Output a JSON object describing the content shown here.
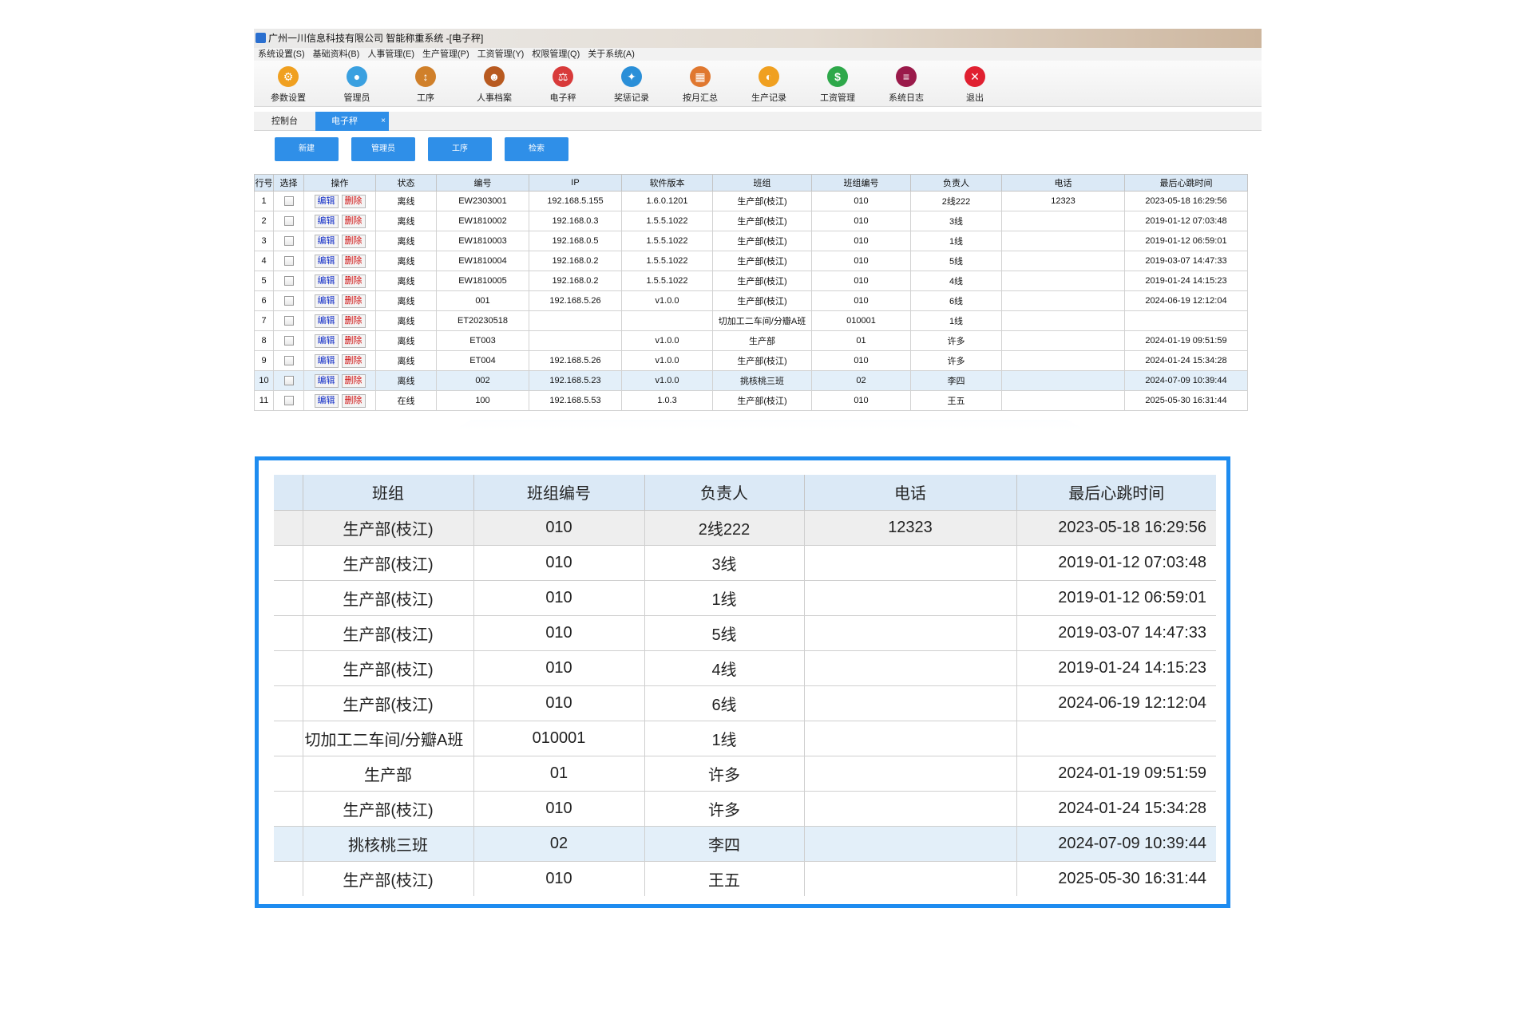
{
  "window": {
    "title": "广州一川信息科技有限公司 智能称重系统 -[电子秤]"
  },
  "menu": [
    "系统设置(S)",
    "基础资料(B)",
    "人事管理(E)",
    "生产管理(P)",
    "工资管理(Y)",
    "权限管理(Q)",
    "关于系统(A)"
  ],
  "toolbar": [
    {
      "label": "参数设置",
      "icon": "gear-icon",
      "color": "#f0a020",
      "glyph": "⚙"
    },
    {
      "label": "管理员",
      "icon": "admin-user-icon",
      "color": "#3aa0e0",
      "glyph": "●"
    },
    {
      "label": "工序",
      "icon": "process-icon",
      "color": "#d0802a",
      "glyph": "↕"
    },
    {
      "label": "人事档案",
      "icon": "personnel-icon",
      "color": "#b85a20",
      "glyph": "☻"
    },
    {
      "label": "电子秤",
      "icon": "scale-icon",
      "color": "#d83a3a",
      "glyph": "⚖"
    },
    {
      "label": "奖惩记录",
      "icon": "reward-icon",
      "color": "#2a8fd8",
      "glyph": "✦"
    },
    {
      "label": "按月汇总",
      "icon": "calendar-icon",
      "color": "#e07830",
      "glyph": "▦"
    },
    {
      "label": "生产记录",
      "icon": "production-icon",
      "color": "#f0a020",
      "glyph": "◐"
    },
    {
      "label": "工资管理",
      "icon": "money-icon",
      "color": "#2ea84a",
      "glyph": "$"
    },
    {
      "label": "系统日志",
      "icon": "log-icon",
      "color": "#9a1a4a",
      "glyph": "≡"
    },
    {
      "label": "退出",
      "icon": "exit-icon",
      "color": "#e02030",
      "glyph": "✕"
    }
  ],
  "tabs": [
    {
      "label": "控制台"
    },
    {
      "label": "电子秤",
      "close": "×"
    }
  ],
  "buttons": {
    "new": "新建",
    "admin": "管理员",
    "process": "工序",
    "search": "检索"
  },
  "grid": {
    "headers": [
      "行号",
      "选择",
      "操作",
      "状态",
      "编号",
      "IP",
      "软件版本",
      "班组",
      "班组编号",
      "负责人",
      "电话",
      "最后心跳时间"
    ],
    "edit_label": "编辑",
    "delete_label": "删除",
    "rows": [
      {
        "no": "1",
        "status": "离线",
        "code": "EW2303001",
        "ip": "192.168.5.155",
        "ver": "1.6.0.1201",
        "team": "生产部(枝江)",
        "team_no": "010",
        "leader": "2线222",
        "phone": "12323",
        "time": "2023-05-18 16:29:56"
      },
      {
        "no": "2",
        "status": "离线",
        "code": "EW1810002",
        "ip": "192.168.0.3",
        "ver": "1.5.5.1022",
        "team": "生产部(枝江)",
        "team_no": "010",
        "leader": "3线",
        "phone": "",
        "time": "2019-01-12 07:03:48"
      },
      {
        "no": "3",
        "status": "离线",
        "code": "EW1810003",
        "ip": "192.168.0.5",
        "ver": "1.5.5.1022",
        "team": "生产部(枝江)",
        "team_no": "010",
        "leader": "1线",
        "phone": "",
        "time": "2019-01-12 06:59:01"
      },
      {
        "no": "4",
        "status": "离线",
        "code": "EW1810004",
        "ip": "192.168.0.2",
        "ver": "1.5.5.1022",
        "team": "生产部(枝江)",
        "team_no": "010",
        "leader": "5线",
        "phone": "",
        "time": "2019-03-07 14:47:33"
      },
      {
        "no": "5",
        "status": "离线",
        "code": "EW1810005",
        "ip": "192.168.0.2",
        "ver": "1.5.5.1022",
        "team": "生产部(枝江)",
        "team_no": "010",
        "leader": "4线",
        "phone": "",
        "time": "2019-01-24 14:15:23"
      },
      {
        "no": "6",
        "status": "离线",
        "code": "001",
        "ip": "192.168.5.26",
        "ver": "v1.0.0",
        "team": "生产部(枝江)",
        "team_no": "010",
        "leader": "6线",
        "phone": "",
        "time": "2024-06-19 12:12:04"
      },
      {
        "no": "7",
        "status": "离线",
        "code": "ET20230518",
        "ip": "",
        "ver": "",
        "team": "切加工二车间/分瓣A班",
        "team_no": "010001",
        "leader": "1线",
        "phone": "",
        "time": ""
      },
      {
        "no": "8",
        "status": "离线",
        "code": "ET003",
        "ip": "",
        "ver": "v1.0.0",
        "team": "生产部",
        "team_no": "01",
        "leader": "许多",
        "phone": "",
        "time": "2024-01-19 09:51:59"
      },
      {
        "no": "9",
        "status": "离线",
        "code": "ET004",
        "ip": "192.168.5.26",
        "ver": "v1.0.0",
        "team": "生产部(枝江)",
        "team_no": "010",
        "leader": "许多",
        "phone": "",
        "time": "2024-01-24 15:34:28"
      },
      {
        "no": "10",
        "status": "离线",
        "code": "002",
        "ip": "192.168.5.23",
        "ver": "v1.0.0",
        "team": "挑核桃三班",
        "team_no": "02",
        "leader": "李四",
        "phone": "",
        "time": "2024-07-09 10:39:44"
      },
      {
        "no": "11",
        "status": "在线",
        "code": "100",
        "ip": "192.168.5.53",
        "ver": "1.0.3",
        "team": "生产部(枝江)",
        "team_no": "010",
        "leader": "王五",
        "phone": "",
        "time": "2025-05-30 16:31:44"
      }
    ]
  },
  "zoom": {
    "headers": [
      "班组",
      "班组编号",
      "负责人",
      "电话",
      "最后心跳时间"
    ],
    "team_row7": "切加工二车间/分瓣A班"
  },
  "colors": {
    "accent": "#2f8fe8",
    "zoom_border": "#1e8cf0",
    "header_bg": "#dbe9f6",
    "offline": "#e0141e",
    "online": "#1530c8"
  }
}
